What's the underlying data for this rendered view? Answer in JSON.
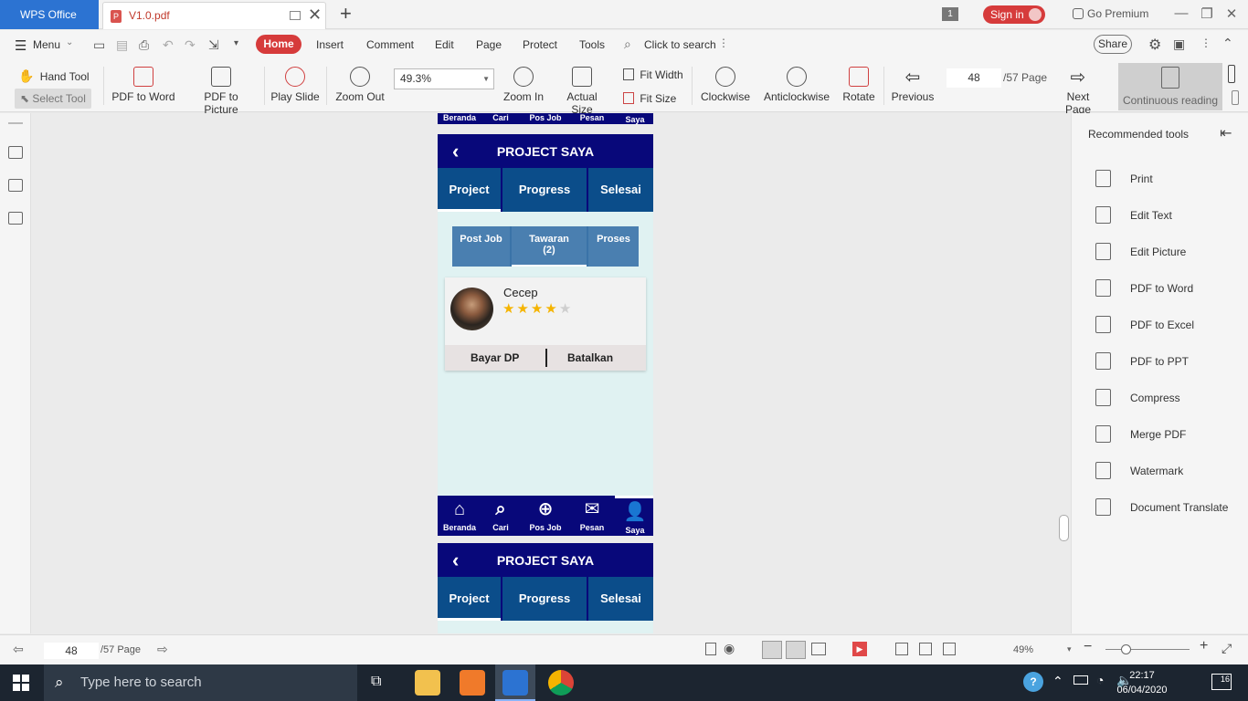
{
  "titlebar": {
    "app_tab": "WPS Office",
    "doc_tab": "V1.0.pdf",
    "new_tab": "+",
    "page_badge": "1",
    "sign_in": "Sign in",
    "go_premium": "Go Premium"
  },
  "menubar": {
    "menu": "Menu",
    "items": [
      "Home",
      "Insert",
      "Comment",
      "Edit",
      "Page",
      "Protect",
      "Tools"
    ],
    "search": "Click to search",
    "share": "Share"
  },
  "toolbar": {
    "hand_tool": "Hand Tool",
    "select_tool": "Select Tool",
    "pdf_to_word": "PDF to Word",
    "pdf_to_picture": "PDF to Picture",
    "play_slide": "Play Slide",
    "zoom_out": "Zoom Out",
    "zoom_value": "49.3%",
    "zoom_in": "Zoom In",
    "actual_size": "Actual Size",
    "fit_width": "Fit Width",
    "fit_size": "Fit Size",
    "clockwise": "Clockwise",
    "anticlockwise": "Anticlockwise",
    "rotate": "Rotate",
    "previous": "Previous",
    "page_current": "48",
    "page_total": "/57 Page",
    "next_page": "Next Page",
    "continuous_reading": "Continuous reading"
  },
  "document": {
    "prev_nav": [
      "Beranda",
      "Cari",
      "Pos Job",
      "Pesan",
      "Saya"
    ],
    "header_title": "PROJECT SAYA",
    "tabs": [
      "Project",
      "Progress",
      "Selesai"
    ],
    "subtabs": [
      "Post Job",
      "Tawaran\n(2)",
      "Proses"
    ],
    "card": {
      "name": "Cecep",
      "rating": 4,
      "rating_max": 5,
      "action_left": "Bayar DP",
      "action_right": "Batalkan"
    },
    "nav": [
      "Beranda",
      "Cari",
      "Pos Job",
      "Pesan",
      "Saya"
    ]
  },
  "rightpanel": {
    "title": "Recommended tools",
    "items": [
      "Print",
      "Edit Text",
      "Edit Picture",
      "PDF to Word",
      "PDF to Excel",
      "PDF to PPT",
      "Compress",
      "Merge PDF",
      "Watermark",
      "Document Translate"
    ]
  },
  "statusbar": {
    "page_current": "48",
    "page_total": "/57 Page",
    "zoom": "49%"
  },
  "taskbar": {
    "search_placeholder": "Type here to search",
    "time": "22:17",
    "date": "06/04/2020",
    "notifications": "16"
  }
}
